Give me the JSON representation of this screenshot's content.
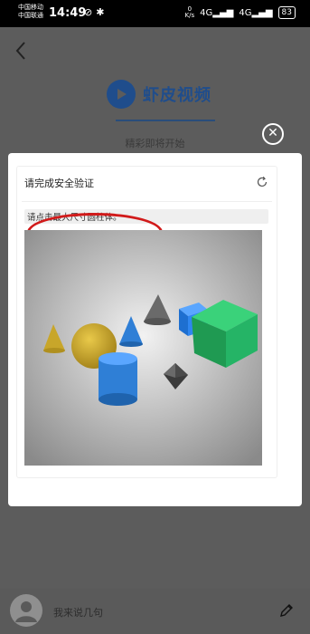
{
  "status_bar": {
    "carrier_1": "中国移动",
    "carrier_2": "中国联通",
    "time": "14:49",
    "speed_value": "0",
    "speed_unit": "K/s",
    "network_1": "4G",
    "network_2": "4G",
    "battery": "83"
  },
  "app": {
    "brand": "虾皮视频",
    "subtitle": "精彩即将开始"
  },
  "captcha_dialog": {
    "title": "请完成安全验证",
    "instruction": "请点击最大尺寸圆柱体。",
    "colors": {
      "red_annotation": "#d11a1a",
      "green_cube": "#25a55a",
      "blue_cylinder": "#2f7fd6",
      "yellow_sphere": "#d7b42a"
    }
  },
  "bottom": {
    "comment_placeholder": "我来说几句"
  },
  "icons": [
    "back-arrow-icon",
    "close-icon",
    "refresh-icon",
    "play-icon",
    "avatar-icon",
    "edit-icon"
  ]
}
